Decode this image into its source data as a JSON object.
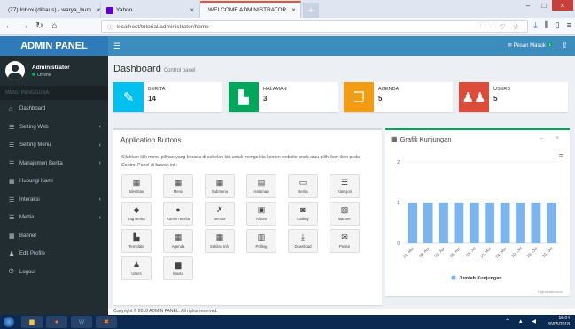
{
  "browser": {
    "tabs": [
      {
        "label": "(77) Inbox (dihaus) - warya_bum",
        "icon_color": "#6a5acd"
      },
      {
        "label": "Yahoo",
        "icon_color": "#6001d2"
      },
      {
        "label": "WELCOME ADMINISTRATOR",
        "icon_color": "#e77a35"
      }
    ],
    "url": "localhost/tutorial/administrator/home"
  },
  "header": {
    "brand": "ADMIN PANEL",
    "hamburger_icon": "hamburger-icon",
    "pesan_label": "Pesan Masuk",
    "pesan_count": "1"
  },
  "sidebar": {
    "user_name": "Administrator",
    "user_status": "Online",
    "menu_heading": "MENU PENGGUNA",
    "items": [
      {
        "label": "Dashboard",
        "icon": "dashboard-icon",
        "glyph": "⌂",
        "chevron": false
      },
      {
        "label": "Setting Web",
        "icon": "list-icon",
        "glyph": "☰",
        "chevron": true
      },
      {
        "label": "Setting Menu",
        "icon": "list-icon",
        "glyph": "☰",
        "chevron": true
      },
      {
        "label": "Manajemen Berita",
        "icon": "list-icon",
        "glyph": "☰",
        "chevron": true
      },
      {
        "label": "Hubungi Kami",
        "icon": "grid-icon",
        "glyph": "▦",
        "chevron": false
      },
      {
        "label": "Interaksi",
        "icon": "list-icon",
        "glyph": "☰",
        "chevron": true
      },
      {
        "label": "Media",
        "icon": "list-icon",
        "glyph": "☰",
        "chevron": true
      },
      {
        "label": "Banner",
        "icon": "grid-icon",
        "glyph": "▦",
        "chevron": false
      },
      {
        "label": "Edit Profile",
        "icon": "user-icon",
        "glyph": "♟",
        "chevron": false
      },
      {
        "label": "Logout",
        "icon": "power-icon",
        "glyph": "⏻",
        "chevron": false
      }
    ]
  },
  "page": {
    "title": "Dashboard",
    "subtitle": "Control panel"
  },
  "infoboxes": [
    {
      "label": "BERITA",
      "value": "14",
      "color": "#00c0ef",
      "icon": "edit-icon",
      "glyph": "✎"
    },
    {
      "label": "HALAMAN",
      "value": "3",
      "color": "#00a65a",
      "icon": "file-icon",
      "glyph": "▙"
    },
    {
      "label": "AGENDA",
      "value": "5",
      "color": "#f39c12",
      "icon": "copy-icon",
      "glyph": "❐"
    },
    {
      "label": "USERS",
      "value": "5",
      "color": "#dd4b39",
      "icon": "users-icon",
      "glyph": "♟♟"
    }
  ],
  "app_box": {
    "title": "Application Buttons",
    "description": "Silahkan klik menu pilihan yang berada di sebelah kiri untuk mengelola konten website anda atau pilih ikon-ikon pada Control Panel di bawah ini :",
    "buttons": [
      {
        "label": "Identitas",
        "icon": "grid-icon",
        "glyph": "▦"
      },
      {
        "label": "Menu",
        "icon": "grid-icon",
        "glyph": "▦"
      },
      {
        "label": "Submenu",
        "icon": "grid-icon",
        "glyph": "▦"
      },
      {
        "label": "Halaman",
        "icon": "file-icon",
        "glyph": "▤"
      },
      {
        "label": "Berita",
        "icon": "monitor-icon",
        "glyph": "▭"
      },
      {
        "label": "Kategori",
        "icon": "list-icon",
        "glyph": "☰"
      },
      {
        "label": "Tag Berita",
        "icon": "tag-icon",
        "glyph": "◆"
      },
      {
        "label": "Komen Berita",
        "icon": "comment-icon",
        "glyph": "●"
      },
      {
        "label": "Sensor",
        "icon": "mute-icon",
        "glyph": "✗"
      },
      {
        "label": "Album",
        "icon": "image-icon",
        "glyph": "▣"
      },
      {
        "label": "Gallery",
        "icon": "camera-icon",
        "glyph": "◙"
      },
      {
        "label": "Banner",
        "icon": "picture-icon",
        "glyph": "▨"
      },
      {
        "label": "Template",
        "icon": "file-icon",
        "glyph": "▙"
      },
      {
        "label": "Agenda",
        "icon": "calendar-icon",
        "glyph": "▦"
      },
      {
        "label": "Sekilas Info",
        "icon": "calendar-icon",
        "glyph": "▦"
      },
      {
        "label": "Polling",
        "icon": "chart-icon",
        "glyph": "▥"
      },
      {
        "label": "Download",
        "icon": "download-icon",
        "glyph": "⤓"
      },
      {
        "label": "Pesan",
        "icon": "mail-icon",
        "glyph": "✉"
      },
      {
        "label": "Users",
        "icon": "users-icon",
        "glyph": "♟"
      },
      {
        "label": "Modul",
        "icon": "folder-icon",
        "glyph": "▆"
      }
    ]
  },
  "chart_box": {
    "title": "Grafik Kunjungan",
    "controls": "– ×",
    "credit": "Highcharts.com"
  },
  "chart_data": {
    "type": "bar",
    "title": "",
    "xlabel": "",
    "ylabel": "",
    "ylim": [
      0,
      2
    ],
    "yticks": [
      "0",
      "1",
      "2"
    ],
    "categories": [
      "21. Mar",
      "08. Apr",
      "01. Apr",
      "05. Apr",
      "01. Jul",
      "10. Mar",
      "04. Mar",
      "30. Okt",
      "29. Okt",
      "30. Okt"
    ],
    "series": [
      {
        "name": "Jumlah Kunjungan",
        "color": "#7cb5ec",
        "values": [
          1,
          1,
          1,
          1,
          1,
          1,
          1,
          1,
          1,
          1
        ]
      }
    ],
    "grid": true,
    "legend": "bottom"
  },
  "footer": {
    "text": "Copyright © 2018 ADMIN PANEL. All rights reserved."
  },
  "taskbar": {
    "time": "15:04",
    "date": "30/05/2018"
  }
}
